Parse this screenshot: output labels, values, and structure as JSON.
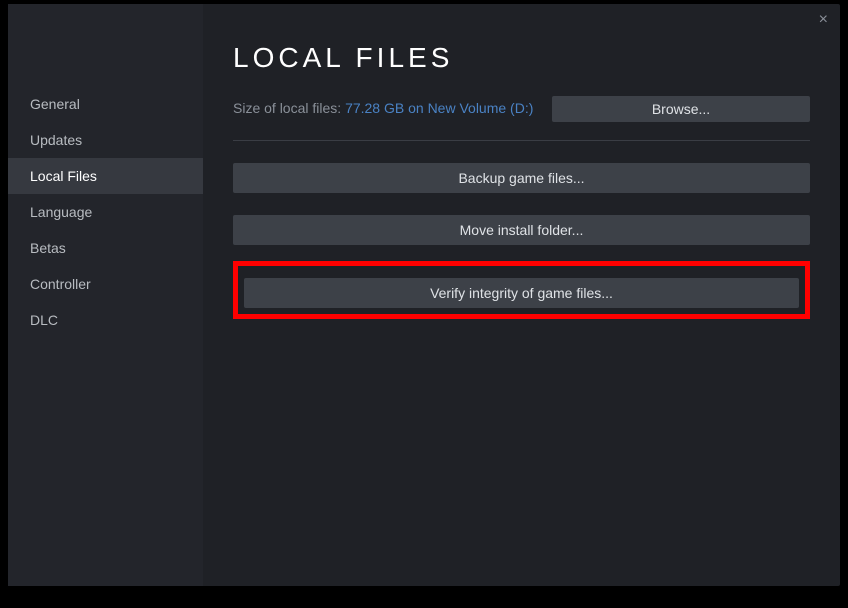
{
  "window": {
    "close_label": "×"
  },
  "sidebar": {
    "items": [
      {
        "label": "General"
      },
      {
        "label": "Updates"
      },
      {
        "label": "Local Files"
      },
      {
        "label": "Language"
      },
      {
        "label": "Betas"
      },
      {
        "label": "Controller"
      },
      {
        "label": "DLC"
      }
    ],
    "active_index": 2
  },
  "main": {
    "title": "LOCAL FILES",
    "size_label": "Size of local files: ",
    "size_value": "77.28 GB on New Volume (D:)",
    "browse_label": "Browse...",
    "backup_label": "Backup game files...",
    "move_label": "Move install folder...",
    "verify_label": "Verify integrity of game files..."
  }
}
